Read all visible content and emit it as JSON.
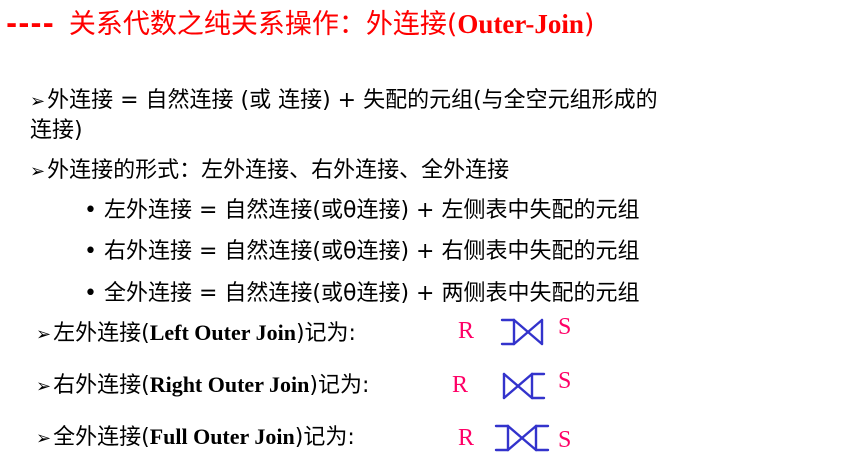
{
  "title": {
    "dashes": "----",
    "text_cn": "关系代数之纯关系操作：外连接(",
    "text_en": "Outer-Join",
    "text_close": ")"
  },
  "lines": {
    "l1a": "外连接 = 自然连接 (或  连接) + 失配的元组(与全空元组形成的",
    "l1b": "连接)",
    "l2": "外连接的形式：左外连接、右外连接、全外连接",
    "b1": "左外连接 = 自然连接(或θ连接) + 左侧表中失配的元组",
    "b2": "右外连接 = 自然连接(或θ连接) + 右侧表中失配的元组",
    "b3": "全外连接 = 自然连接(或θ连接) + 两侧表中失配的元组",
    "left_cn": "左外连接(",
    "left_en": "Left Outer Join",
    "left_tail": ")记为:",
    "right_cn": "右外连接(",
    "right_en": "Right Outer Join",
    "right_tail": ")记为:",
    "full_cn": "全外连接(",
    "full_en": "Full Outer Join",
    "full_tail": ")记为:"
  },
  "symbols": {
    "arrow": "➢",
    "bullet": "•",
    "R": "R",
    "S": "S"
  },
  "colors": {
    "title": "#ff0000",
    "symbol_letters": "#ff0066",
    "join_icon": "#3333cc"
  }
}
